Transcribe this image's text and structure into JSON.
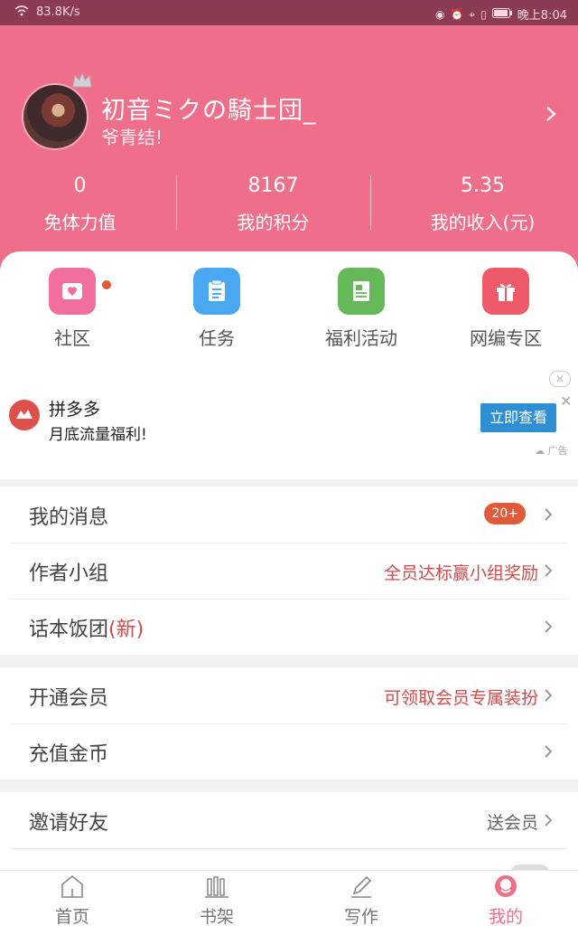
{
  "status_bar": {
    "network_speed": "83.8K/s",
    "time": "晚上8:04"
  },
  "profile": {
    "username": "初音ミクの騎士団_",
    "signature": "爷青结!"
  },
  "stats": [
    {
      "value": "0",
      "label": "免体力值"
    },
    {
      "value": "8167",
      "label": "我的积分"
    },
    {
      "value": "5.35",
      "label": "我的收入(元)"
    }
  ],
  "quick_actions": [
    {
      "label": "社区",
      "icon": "heart-mail-icon",
      "color": "#f06f9e"
    },
    {
      "label": "任务",
      "icon": "clipboard-icon",
      "color": "#4aa8f0"
    },
    {
      "label": "福利活动",
      "icon": "document-icon",
      "color": "#67b85a"
    },
    {
      "label": "网编专区",
      "icon": "gift-icon",
      "color": "#ef5a6a"
    }
  ],
  "ad": {
    "title": "拼多多",
    "description": "月底流量福利!",
    "button": "立即查看",
    "mark": "广告"
  },
  "menu_section_1": {
    "messages": {
      "label": "我的消息",
      "badge": "20+"
    },
    "author_group": {
      "label": "作者小组",
      "value": "全员达标赢小组奖励"
    },
    "fan_club": {
      "label": "话本饭团",
      "tag": "(新)"
    }
  },
  "menu_section_2": {
    "membership": {
      "label": "开通会员",
      "value": "可领取会员专属装扮"
    },
    "recharge": {
      "label": "充值金币"
    }
  },
  "menu_section_3": {
    "invite": {
      "label": "邀请好友",
      "value": "送会员"
    }
  },
  "bottom_nav": [
    {
      "label": "首页",
      "icon": "home-icon"
    },
    {
      "label": "书架",
      "icon": "bookshelf-icon"
    },
    {
      "label": "写作",
      "icon": "pen-icon"
    },
    {
      "label": "我的",
      "icon": "profile-icon",
      "active": true
    }
  ],
  "colors": {
    "brand_pink": "#ef6e8a",
    "highlight_red": "#d24a4a",
    "badge_orange": "#e05a3a"
  }
}
